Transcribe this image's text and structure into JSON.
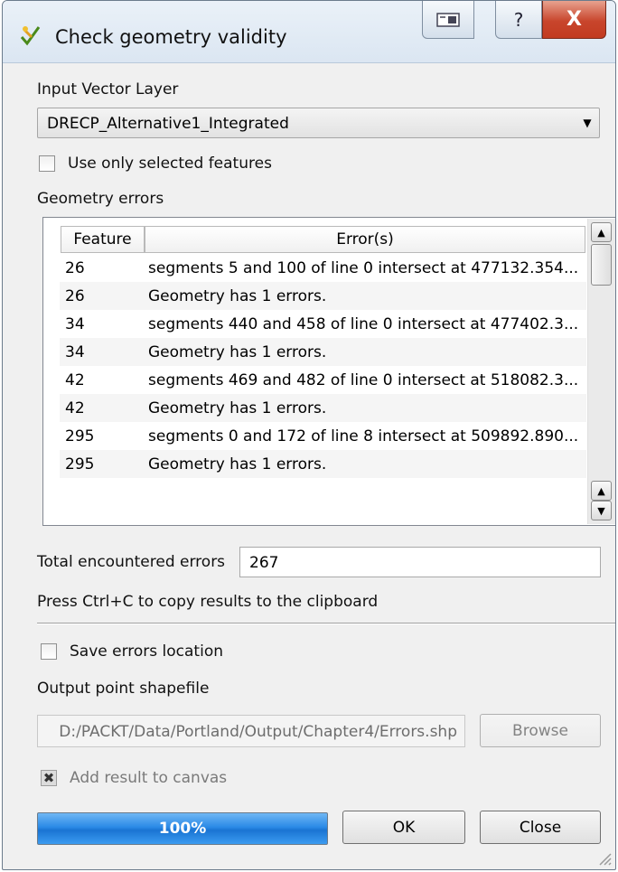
{
  "window": {
    "title": "Check geometry validity",
    "help_glyph": "?",
    "close_glyph": "X"
  },
  "input": {
    "label": "Input Vector Layer",
    "layer": "DRECP_Alternative1_Integrated",
    "use_selected_label": "Use only selected features",
    "use_selected_checked": false
  },
  "errors": {
    "label": "Geometry errors",
    "columns": [
      "Feature",
      "Error(s)"
    ],
    "rows": [
      {
        "feature": "26",
        "error": "segments 5 and 100 of line 0 intersect at 477132.354..."
      },
      {
        "feature": "26",
        "error": "Geometry has 1 errors."
      },
      {
        "feature": "34",
        "error": "segments 440 and 458 of line 0 intersect at 477402.3..."
      },
      {
        "feature": "34",
        "error": "Geometry has 1 errors."
      },
      {
        "feature": "42",
        "error": "segments 469 and 482 of line 0 intersect at 518082.3..."
      },
      {
        "feature": "42",
        "error": "Geometry has 1 errors."
      },
      {
        "feature": "295",
        "error": "segments 0 and 172 of line 8 intersect at 509892.890..."
      },
      {
        "feature": "295",
        "error": "Geometry has 1 errors."
      }
    ]
  },
  "summary": {
    "total_label": "Total encountered errors",
    "total_value": "267",
    "copy_hint": "Press Ctrl+C to copy results to the clipboard"
  },
  "output": {
    "save_label": "Save errors location",
    "save_checked": false,
    "shapefile_label": "Output point shapefile",
    "shapefile_path": "D:/PACKT/Data/Portland/Output/Chapter4/Errors.shp",
    "browse_label": "Browse",
    "add_to_canvas_label": "Add result to canvas",
    "add_to_canvas_checked": true
  },
  "footer": {
    "progress_text": "100%",
    "progress_value": 100,
    "ok_label": "OK",
    "close_label": "Close"
  },
  "colors": {
    "progress_fill": "#2b8ae6",
    "close_button": "#c8452c"
  }
}
